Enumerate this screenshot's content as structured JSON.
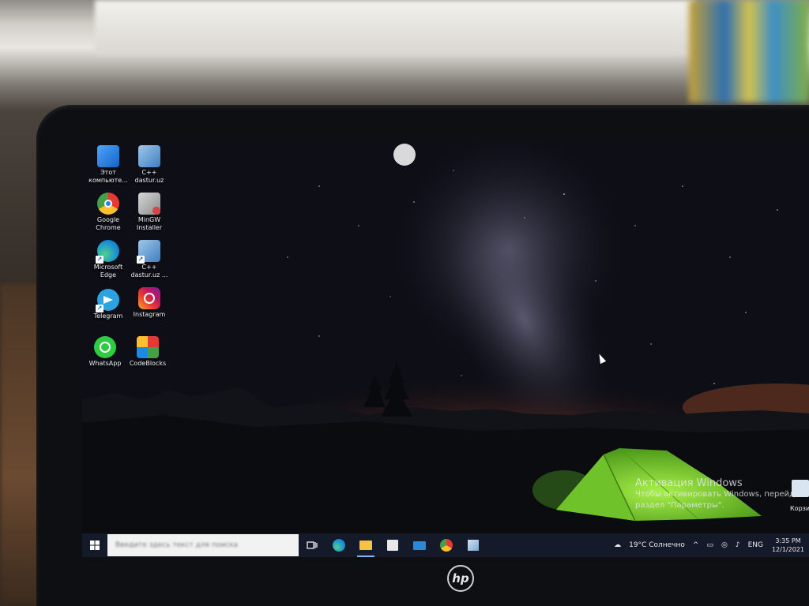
{
  "desktop": {
    "icons": [
      {
        "label": "Этот\nкомпьюте...",
        "icon": "computer-icon"
      },
      {
        "label": "C++\ndastur.uz",
        "icon": "cpp-installer-icon"
      },
      {
        "label": "Google\nChrome",
        "icon": "chrome-icon"
      },
      {
        "label": "MinGW\nInstaller",
        "icon": "mingw-icon"
      },
      {
        "label": "Microsoft\nEdge",
        "icon": "edge-icon"
      },
      {
        "label": "C++\ndastur.uz ...",
        "icon": "cpp-installer-icon"
      },
      {
        "label": "Telegram",
        "icon": "telegram-icon"
      },
      {
        "label": "Instagram",
        "icon": "instagram-icon"
      },
      {
        "label": "WhatsApp",
        "icon": "whatsapp-icon"
      },
      {
        "label": "CodeBlocks",
        "icon": "codeblocks-icon"
      }
    ],
    "recycle_bin_label": "Корзи"
  },
  "activation": {
    "title": "Активация Windows",
    "line1": "Чтобы активировать Windows, перейдите",
    "line2": "раздел \"Параметры\"."
  },
  "taskbar": {
    "search_placeholder": "Введите здесь текст для поиска",
    "weather": "19°C Солнечно",
    "language": "ENG",
    "time": "3:35 PM",
    "date": "12/1/2021"
  },
  "colors": {
    "taskbar": "#141a2a",
    "tent": "#7ed12f",
    "horizon_glow": "#d9692a"
  }
}
